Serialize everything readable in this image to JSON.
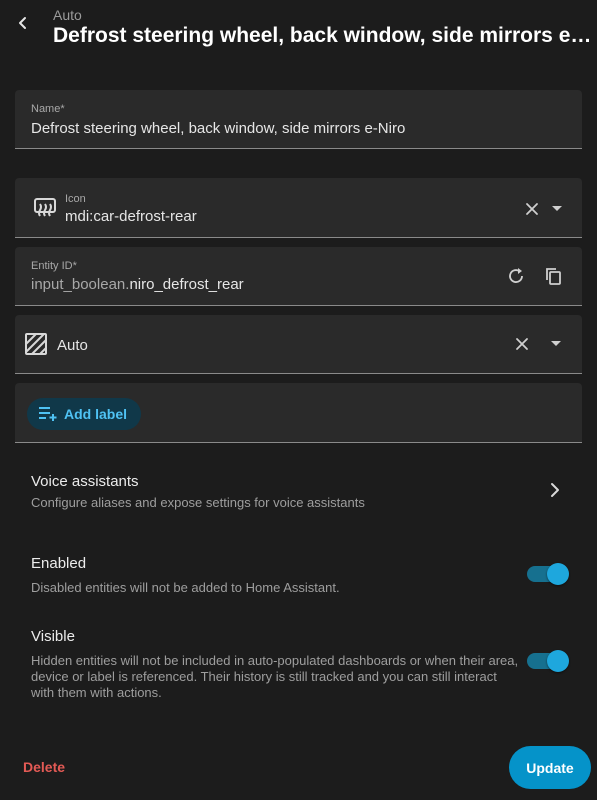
{
  "header": {
    "subtitle": "Auto",
    "title": "Defrost steering wheel, back window, side mirrors e-Niro"
  },
  "name_field": {
    "label": "Name*",
    "value": "Defrost steering wheel, back window, side mirrors e-Niro"
  },
  "icon_field": {
    "label": "Icon",
    "value": "mdi:car-defrost-rear"
  },
  "entity_field": {
    "label": "Entity ID*",
    "prefix": "input_boolean.",
    "value": "niro_defrost_rear"
  },
  "area_field": {
    "value": "Auto"
  },
  "labels": {
    "add_label": "Add label"
  },
  "voice": {
    "title": "Voice assistants",
    "description": "Configure aliases and expose settings for voice assistants"
  },
  "enabled": {
    "title": "Enabled",
    "description": "Disabled entities will not be added to Home Assistant.",
    "on": true
  },
  "visible": {
    "title": "Visible",
    "description": "Hidden entities will not be included in auto-populated dashboards or when their area, device or label is referenced. Their history is still tracked and you can still interact with them with actions.",
    "on": true
  },
  "footer": {
    "delete_label": "Delete",
    "update_label": "Update"
  },
  "colors": {
    "background": "#1c1c1c",
    "field": "#2a2a2a",
    "primary": "#0593c9",
    "danger": "#e35a55"
  }
}
